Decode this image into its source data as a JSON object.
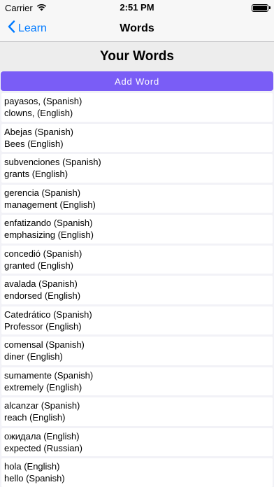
{
  "status": {
    "carrier": "Carrier",
    "time": "2:51 PM"
  },
  "nav": {
    "back_label": "Learn",
    "title": "Words"
  },
  "header": {
    "title": "Your Words"
  },
  "add_button": {
    "label": "Add Word"
  },
  "words": [
    {
      "line1": "payasos, (Spanish)",
      "line2": "clowns, (English)"
    },
    {
      "line1": "Abejas (Spanish)",
      "line2": "Bees (English)"
    },
    {
      "line1": "subvenciones (Spanish)",
      "line2": "grants (English)"
    },
    {
      "line1": "gerencia (Spanish)",
      "line2": "management (English)"
    },
    {
      "line1": "enfatizando (Spanish)",
      "line2": "emphasizing (English)"
    },
    {
      "line1": "concedió (Spanish)",
      "line2": "granted (English)"
    },
    {
      "line1": "avalada (Spanish)",
      "line2": "endorsed (English)"
    },
    {
      "line1": "Catedrático (Spanish)",
      "line2": "Professor (English)"
    },
    {
      "line1": "comensal (Spanish)",
      "line2": "diner (English)"
    },
    {
      "line1": "sumamente (Spanish)",
      "line2": "extremely (English)"
    },
    {
      "line1": "alcanzar (Spanish)",
      "line2": "reach (English)"
    },
    {
      "line1": "ожидала (English)",
      "line2": "expected (Russian)"
    },
    {
      "line1": "hola (English)",
      "line2": "hello (Spanish)"
    }
  ],
  "icons": {
    "wifi": "wifi-icon",
    "battery": "battery-icon",
    "back": "chevron-left-icon"
  },
  "colors": {
    "accent": "#007aff",
    "add_button": "#7a5df6"
  }
}
